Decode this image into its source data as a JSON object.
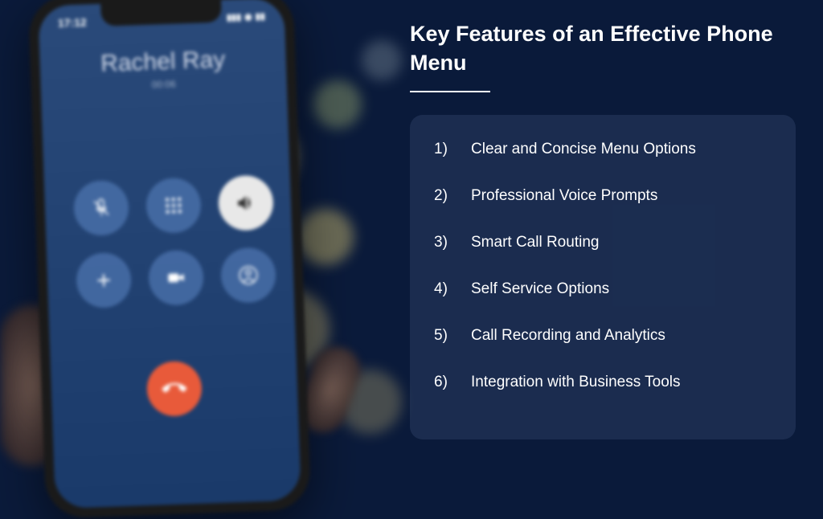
{
  "phone": {
    "time": "17:12",
    "caller_name": "Rachel Ray",
    "call_duration": "00:06"
  },
  "title": "Key Features of an Effective Phone Menu",
  "features": [
    {
      "num": "1)",
      "text": "Clear and Concise Menu Options"
    },
    {
      "num": "2)",
      "text": "Professional Voice Prompts"
    },
    {
      "num": "3)",
      "text": "Smart Call Routing"
    },
    {
      "num": "4)",
      "text": "Self Service Options"
    },
    {
      "num": "5)",
      "text": "Call Recording and Analytics"
    },
    {
      "num": "6)",
      "text": "Integration with Business Tools"
    }
  ]
}
